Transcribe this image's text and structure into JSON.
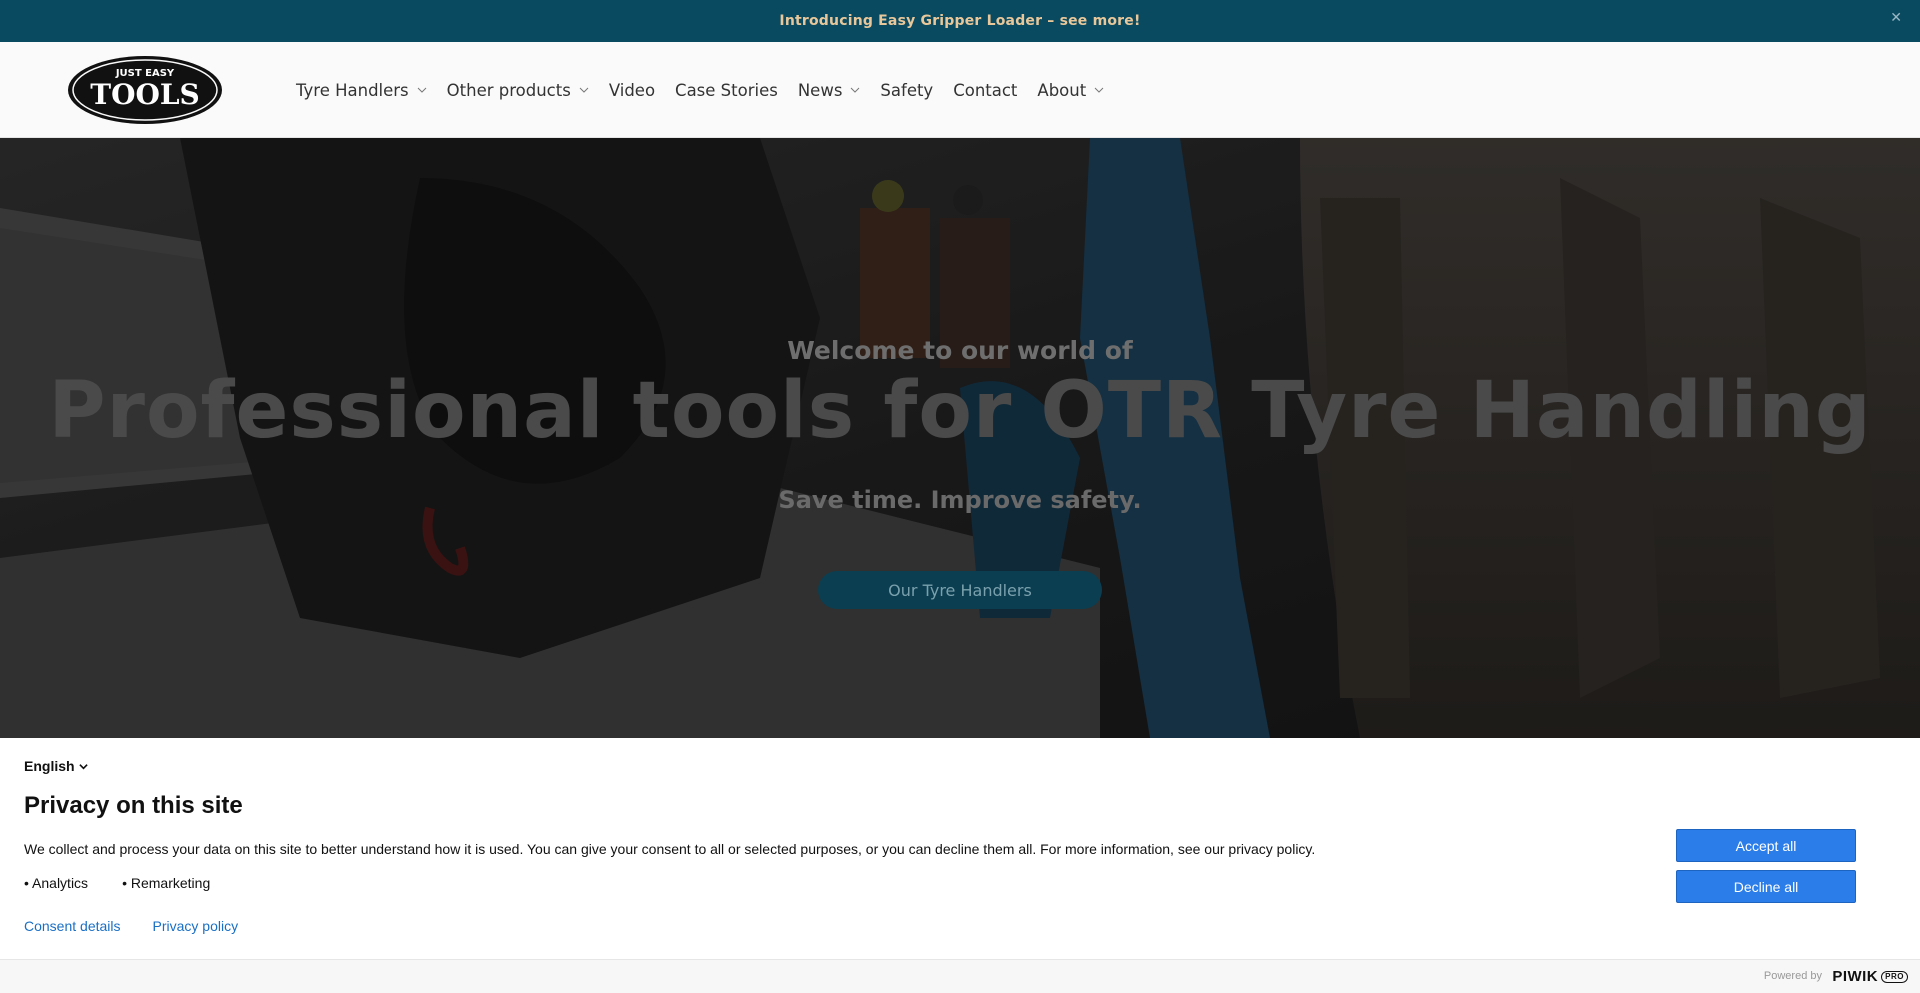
{
  "announcement": {
    "text": "Introducing Easy Gripper Loader – see more!",
    "close_icon": "close-icon"
  },
  "header": {
    "logo": {
      "top_text": "JUST EASY",
      "main_text": "TOOLS"
    },
    "nav": [
      {
        "label": "Tyre Handlers",
        "has_dropdown": true
      },
      {
        "label": "Other products",
        "has_dropdown": true
      },
      {
        "label": "Video",
        "has_dropdown": false
      },
      {
        "label": "Case Stories",
        "has_dropdown": false
      },
      {
        "label": "News",
        "has_dropdown": true
      },
      {
        "label": "Safety",
        "has_dropdown": false
      },
      {
        "label": "Contact",
        "has_dropdown": false
      },
      {
        "label": "About",
        "has_dropdown": true
      }
    ]
  },
  "hero": {
    "welcome": "Welcome to our world of",
    "title": "Professional tools for OTR Tyre Handling",
    "subtitle": "Save time. Improve safety.",
    "cta": "Our Tyre Handlers"
  },
  "consent": {
    "language": "English",
    "title": "Privacy on this site",
    "body": "We collect and process your data on this site to better understand how it is used. You can give your consent to all or selected purposes, or you can decline them all. For more information, see our privacy policy.",
    "purposes": [
      "Analytics",
      "Remarketing"
    ],
    "links": {
      "details": "Consent details",
      "policy": "Privacy policy"
    },
    "buttons": {
      "accept": "Accept all",
      "decline": "Decline all"
    }
  },
  "footer": {
    "powered_by": "Powered by",
    "brand": "PIWIK",
    "brand_suffix": "PRO"
  },
  "colors": {
    "announce_bg": "#0a4a60",
    "announce_text": "#e8c89a",
    "button_blue": "#2b7de9",
    "link_blue": "#1a6fc4",
    "cta_bg": "#0b3e50"
  }
}
